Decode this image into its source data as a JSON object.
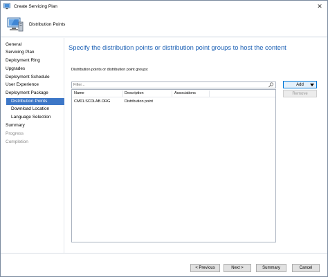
{
  "window": {
    "title": "Create Servicing Plan",
    "close_glyph": "✕"
  },
  "header": {
    "title": "Distribution Points",
    "icon": "computer-icon"
  },
  "sidebar": {
    "items": [
      {
        "label": "General"
      },
      {
        "label": "Servicing Plan"
      },
      {
        "label": "Deployment Ring"
      },
      {
        "label": "Upgrades"
      },
      {
        "label": "Deployment Schedule"
      },
      {
        "label": "User Experience"
      },
      {
        "label": "Deployment Package"
      },
      {
        "label": "Distribution Points",
        "selected": true
      },
      {
        "label": "Download Location"
      },
      {
        "label": "Language Selection"
      },
      {
        "label": "Summary"
      },
      {
        "label": "Progress",
        "disabled": true
      },
      {
        "label": "Completion",
        "disabled": true
      }
    ]
  },
  "main": {
    "heading": "Specify the distribution points or distribution point groups to host the content",
    "group_label": "Distribution points or distribution point groups:",
    "filter_placeholder": "Filter...",
    "columns": [
      "Name",
      "Description",
      "Associations"
    ],
    "rows": [
      {
        "name": "CM01.SCDLAB.ORG",
        "description": "Distribution point",
        "associations": ""
      }
    ],
    "add_label": "Add",
    "remove_label": "Remove"
  },
  "footer": {
    "previous_label": "< Previous",
    "next_label": "Next >",
    "summary_label": "Summary",
    "cancel_label": "Cancel"
  },
  "colors": {
    "accent": "#1a5fb4",
    "selection": "#3d77c7"
  }
}
